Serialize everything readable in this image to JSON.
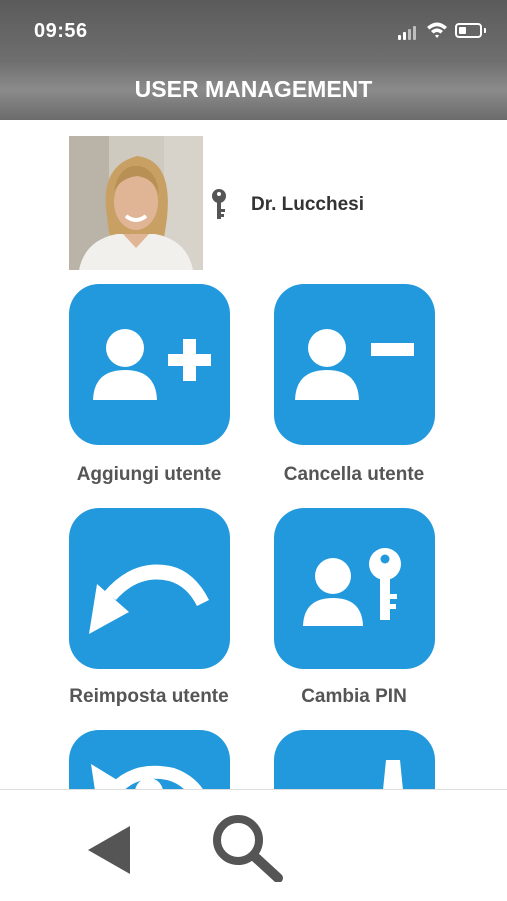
{
  "status_bar": {
    "time": "09:56"
  },
  "header": {
    "title": "USER MANAGEMENT"
  },
  "user": {
    "name": "Dr. Lucchesi",
    "photo_icon": "user-photo",
    "key_icon": "key-icon"
  },
  "tiles": [
    {
      "label": "Aggiungi utente",
      "icon": "add-user-icon"
    },
    {
      "label": "Cancella utente",
      "icon": "remove-user-icon"
    },
    {
      "label": "Reimposta utente",
      "icon": "reset-arrow-icon"
    },
    {
      "label": "Cambia PIN",
      "icon": "user-key-icon"
    },
    {
      "label": "",
      "icon": "sync-icon"
    },
    {
      "label": "",
      "icon": "device-icon"
    }
  ],
  "bottom_nav": {
    "back_icon": "back-triangle-icon",
    "search_icon": "search-icon"
  },
  "colors": {
    "accent": "#2299dc",
    "header": "#7a7a7a",
    "label": "#555555"
  }
}
